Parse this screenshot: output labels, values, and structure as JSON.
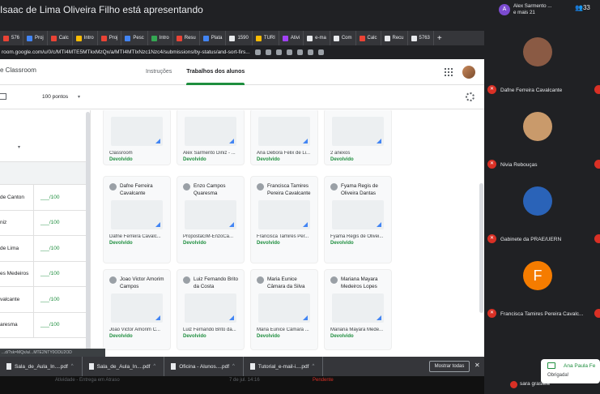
{
  "presenter": {
    "text": "Isaac de Lima Oliveira Filho está apresentando"
  },
  "tabs": [
    {
      "label": "576",
      "color": "#ea4335"
    },
    {
      "label": "Proj",
      "color": "#4285f4"
    },
    {
      "label": "Calc",
      "color": "#ea4335"
    },
    {
      "label": "Intro",
      "color": "#fbbc04"
    },
    {
      "label": "Proj",
      "color": "#ea4335"
    },
    {
      "label": "Pesc",
      "color": "#4285f4"
    },
    {
      "label": "Intro",
      "color": "#34a853"
    },
    {
      "label": "Resu",
      "color": "#ea4335"
    },
    {
      "label": "Plata",
      "color": "#4285f4"
    },
    {
      "label": "1590",
      "color": "#e8eaed"
    },
    {
      "label": "TURI",
      "color": "#fbbc04"
    },
    {
      "label": "Ativi",
      "color": "#a142f4"
    },
    {
      "label": "e-ma",
      "color": "#e8eaed"
    },
    {
      "label": "Com",
      "color": "#e8eaed"
    },
    {
      "label": "Calc",
      "color": "#ea4335"
    },
    {
      "label": "Recu",
      "color": "#e8eaed"
    },
    {
      "label": "5763",
      "color": "#e8eaed"
    }
  ],
  "tab_plus": "+",
  "url": "room.google.com/u/0/c/MTI4MTE5MTkxMzQx/a/MTI4MTIxNzc1Nzc4/submissions/by-status/and-sort-firs...",
  "app": {
    "title": "e Classroom",
    "nav": [
      "Instruções",
      "Trabalhos dos alunos"
    ],
    "points": "100 pontos",
    "caret": "▾"
  },
  "students": [
    {
      "name": "de Canton",
      "grade": "___/100"
    },
    {
      "name": "niz",
      "grade": "___/100"
    },
    {
      "name": "de Lima",
      "grade": "___/100"
    },
    {
      "name": "es Medeiros",
      "grade": "___/100"
    },
    {
      "name": "valcante",
      "grade": "___/100"
    },
    {
      "name": "aresma",
      "grade": "___/100"
    }
  ],
  "list_caret": "▾",
  "cards_row1": [
    {
      "title": "Classroom",
      "status": "Devolvido"
    },
    {
      "title": "Alex Sarmento Diniz - ...",
      "status": "Devolvido"
    },
    {
      "title": "Ana Debora Felix de Li...",
      "status": "Devolvido"
    },
    {
      "title": "2 anexos",
      "status": "Devolvido"
    }
  ],
  "cards": [
    {
      "name": "Dafne Ferreira Cavalcante",
      "title": "Dafne Ferreira Cavalc...",
      "status": "Devolvido"
    },
    {
      "name": "Enzo Campos Quaresma",
      "title": "PropostaGM-EnzoCa...",
      "status": "Devolvido"
    },
    {
      "name": "Francisca Tamires Pereira Cavalcante",
      "title": "Francisca Tamires Per...",
      "status": "Devolvido"
    },
    {
      "name": "Fyama Regis de Oliveira Dantas",
      "title": "Fyama Regis de Olivei...",
      "status": "Devolvido"
    },
    {
      "name": "Joao Victor Amorim Campos",
      "title": "Joao Victor Amorim C...",
      "status": "Devolvido"
    },
    {
      "name": "Luiz Fernando Brito da Costa",
      "title": "Luiz Fernando Brito da...",
      "status": "Devolvido"
    },
    {
      "name": "Maria Eunice Câmara da Silva",
      "title": "Maria Eunice Câmara ...",
      "status": "Devolvido"
    },
    {
      "name": "Mariana Mayara Medeiros Lopes",
      "title": "Mariana Mayara Mede...",
      "status": "Devolvido"
    }
  ],
  "status_url": "...d/?sk=MQx/a/...MTE2NTY0ODU2OD",
  "downloads": [
    {
      "name": "Sala_de_Aula_In....pdf"
    },
    {
      "name": "Sala_de_Aula_In....pdf"
    },
    {
      "name": "Oficina - Alunos....pdf"
    },
    {
      "name": "Tutorial_e-mail-i....pdf"
    }
  ],
  "show_all": "Mostrar todas",
  "dl_close": "✕",
  "bottom": {
    "left": "Atividade - Entrega em Atraso",
    "mid": "7 de jul. 14:16",
    "right": "Pendente"
  },
  "meet": {
    "top_initial": "A",
    "top_name": "Alex Sarmento ...",
    "top_more": "e mais 21",
    "count": "33",
    "participants": [
      {
        "name": "Dafne Ferreira Cavalcante",
        "color": "#8a5a44"
      },
      {
        "name": "Nivia Rebouças",
        "color": "#c99a6b"
      },
      {
        "name": "Gabinete da PRAE/UERN",
        "color": "#2a63b8"
      },
      {
        "name": "Francisca Tamires Pereira Cavalc...",
        "color": "#f57c00",
        "initial": "F"
      }
    ],
    "notif_title": "Ana Paula Fe",
    "notif_sub": "Obrigada!",
    "sara": "sara grasiele"
  }
}
